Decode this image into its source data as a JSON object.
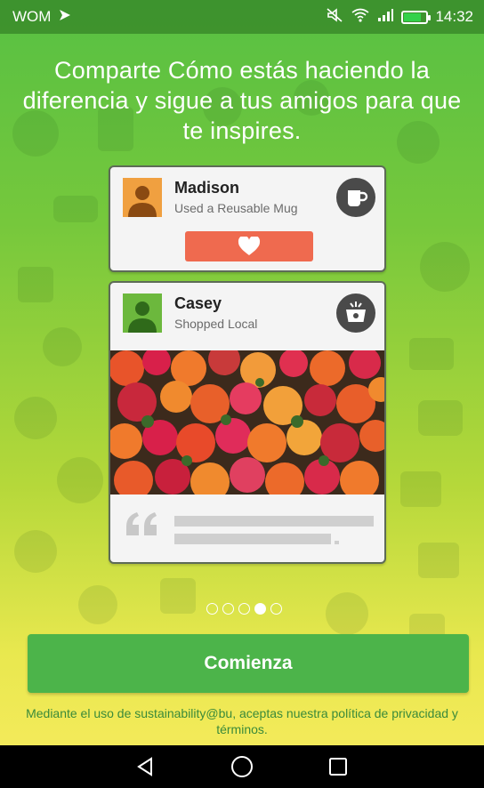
{
  "status_bar": {
    "carrier": "WOM",
    "time": "14:32",
    "icons": [
      "cast-icon",
      "mute-icon",
      "wifi-icon",
      "signal-icon",
      "battery-icon"
    ]
  },
  "headline": "Comparte Cómo estás haciendo la diferencia y sigue a tus amigos para que te inspires.",
  "cards": [
    {
      "name": "Madison",
      "action": "Used a Reusable Mug",
      "icon": "mug-icon",
      "like_icon": "heart-icon",
      "accent": "#ef6a4f"
    },
    {
      "name": "Casey",
      "action": "Shopped Local",
      "icon": "shopping-basket-icon",
      "photo": "tomatoes-photo"
    }
  ],
  "pagination": {
    "total": 5,
    "active_index": 3
  },
  "cta": {
    "label": "Comienza",
    "color": "#4cb44a"
  },
  "legal": "Mediante el uso de sustainability@bu, aceptas nuestra política de privacidad y términos.",
  "nav_bar": {
    "icons": [
      "back-icon",
      "home-icon",
      "recents-icon"
    ]
  }
}
